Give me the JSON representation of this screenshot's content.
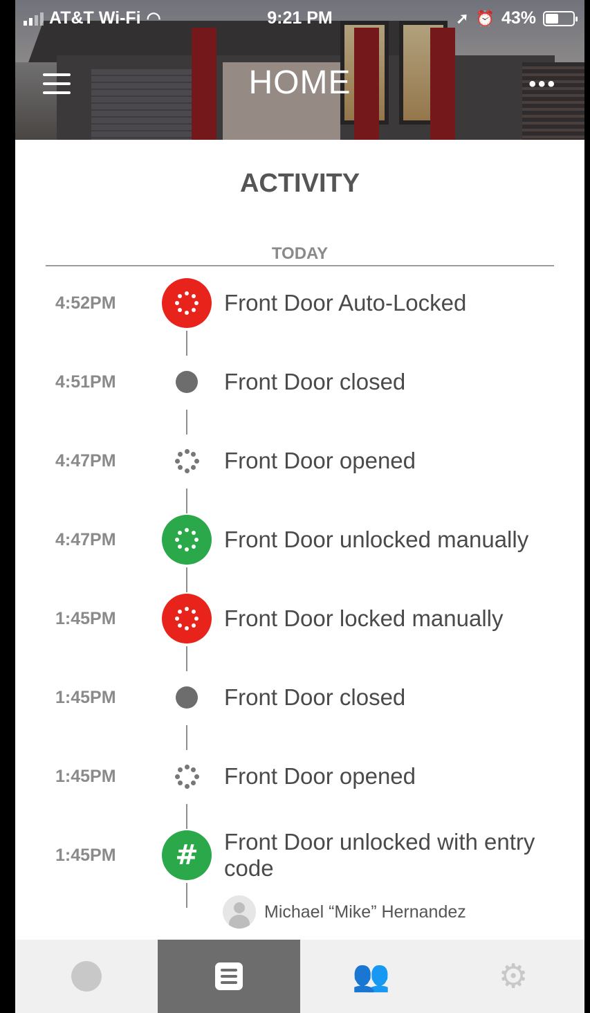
{
  "status_bar": {
    "carrier": "AT&T Wi-Fi",
    "time": "9:21 PM",
    "battery": "43%",
    "icons": [
      "signal-icon",
      "wifi-icon",
      "location-icon",
      "alarm-icon",
      "battery-icon"
    ]
  },
  "header": {
    "title": "HOME",
    "more_label": "•••"
  },
  "activity": {
    "title": "ACTIVITY",
    "day_label": "TODAY",
    "events": [
      {
        "time": "4:52PM",
        "text": "Front Door Auto-Locked",
        "icon": "lock-ring-icon",
        "color": "#e8231c"
      },
      {
        "time": "4:51PM",
        "text": "Front Door closed",
        "icon": "door-closed-dot-icon",
        "color": "#6d6d6d"
      },
      {
        "time": "4:47PM",
        "text": "Front Door opened",
        "icon": "door-opened-ring-icon",
        "color": "#777777"
      },
      {
        "time": "4:47PM",
        "text": "Front Door unlocked manually",
        "icon": "unlock-ring-icon",
        "color": "#2aa84a"
      },
      {
        "time": "1:45PM",
        "text": "Front Door locked manually",
        "icon": "lock-ring-icon",
        "color": "#e8231c"
      },
      {
        "time": "1:45PM",
        "text": "Front Door closed",
        "icon": "door-closed-dot-icon",
        "color": "#6d6d6d"
      },
      {
        "time": "1:45PM",
        "text": "Front Door opened",
        "icon": "door-opened-ring-icon",
        "color": "#777777"
      },
      {
        "time": "1:45PM",
        "text": "Front Door unlocked with entry code",
        "icon": "keypad-hash-icon",
        "color": "#2aa84a"
      }
    ],
    "last_event_user": "Michael “Mike” Hernandez"
  },
  "tabs": [
    {
      "name": "lock-status",
      "icon": "circle-icon",
      "active": false
    },
    {
      "name": "activity",
      "icon": "list-icon",
      "active": true
    },
    {
      "name": "guests",
      "icon": "users-icon",
      "active": false
    },
    {
      "name": "settings",
      "icon": "gear-icon",
      "active": false
    }
  ]
}
